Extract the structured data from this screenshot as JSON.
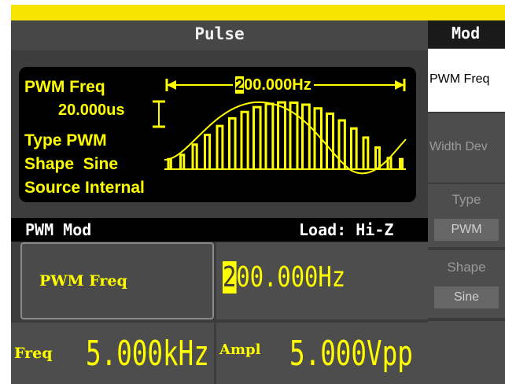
{
  "header": {
    "title": "Pulse"
  },
  "waveform": {
    "param_label": "PWM Freq",
    "deviation_value": "20.000us",
    "type_line": "Type PWM",
    "shape_line": "Shape  Sine",
    "source_line": "Source Internal",
    "freq_cursor_digit": "2",
    "freq_marker_value": "00.000Hz"
  },
  "status": {
    "mode": "PWM Mod",
    "load": "Load: Hi-Z"
  },
  "params": {
    "pwm_freq_label": "PWM Freq",
    "pwm_freq_cursor_digit": "2",
    "pwm_freq_rest": "00.000Hz",
    "freq_label": "Freq",
    "freq_value": "5.000kHz",
    "ampl_label": "Ampl",
    "ampl_value": "5.000Vpp"
  },
  "softkeys": {
    "header": "Mod",
    "pwm_freq": "PWM Freq",
    "width_dev": "Width Dev",
    "type_label": "Type",
    "type_value": "PWM",
    "shape_label": "Shape",
    "shape_value": "Sine"
  },
  "colors": {
    "accent": "#ffff00",
    "topbar": "#f4e400",
    "panel": "#4d4d4d"
  }
}
